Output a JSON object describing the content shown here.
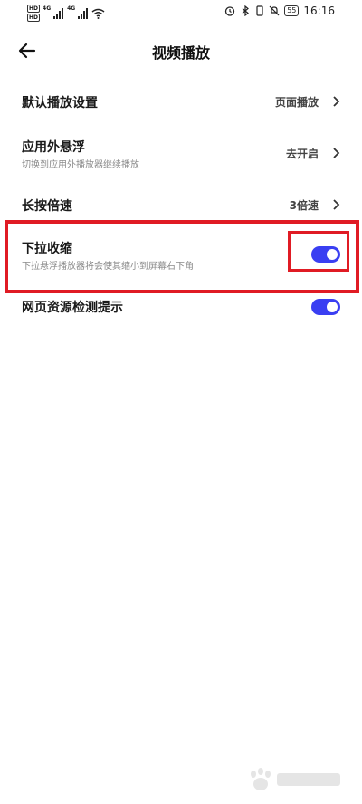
{
  "status_bar": {
    "sim1": "HD",
    "sim2": "HD",
    "net1": "4G",
    "net2": "4G",
    "battery": "55",
    "time": "16:16"
  },
  "header": {
    "title": "视频播放"
  },
  "settings": [
    {
      "title": "默认播放设置",
      "value": "页面播放"
    },
    {
      "title": "应用外悬浮",
      "subtitle": "切换到应用外播放器继续播放",
      "value": "去开启"
    },
    {
      "title": "长按倍速",
      "value": "3倍速"
    },
    {
      "title": "下拉收缩",
      "subtitle": "下拉悬浮播放器将会使其缩小到屏幕右下角",
      "toggle": true
    },
    {
      "title": "网页资源检测提示",
      "toggle": true
    }
  ],
  "colors": {
    "toggle_on": "#3a3ff2",
    "highlight": "#e01b24"
  }
}
